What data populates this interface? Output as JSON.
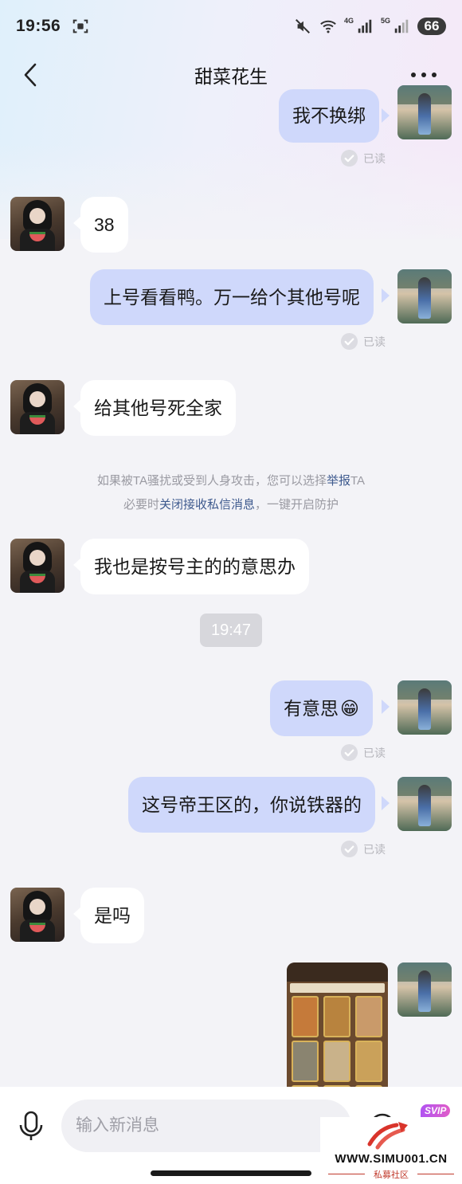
{
  "status_bar": {
    "time": "19:56",
    "battery": "66",
    "net_4g": "4G",
    "net_5g": "5G"
  },
  "header": {
    "title": "甜菜花生"
  },
  "messages": [
    {
      "side": "right",
      "text": "我不换绑",
      "read": "已读"
    },
    {
      "side": "left",
      "text": "38"
    },
    {
      "side": "right",
      "text": "上号看看鸭。万一给个其他号呢",
      "read": "已读"
    },
    {
      "side": "left",
      "text": "给其他号死全家"
    },
    {
      "side": "left",
      "text": "我也是按号主的的意思办"
    },
    {
      "side": "right",
      "text": "有意思",
      "emoji": "😁",
      "read": "已读"
    },
    {
      "side": "right",
      "text": "这号帝王区的，你说铁器的",
      "read": "已读"
    },
    {
      "side": "left",
      "text": "是吗"
    },
    {
      "side": "right",
      "type": "image"
    }
  ],
  "notice": {
    "line1_pre": "如果被TA骚扰或受到人身攻击，您可以选择",
    "line1_link": "举报",
    "line1_post": "TA",
    "line2_pre": "必要时",
    "line2_link": "关闭接收私信消息",
    "line2_post": "，一键开启防护"
  },
  "timestamp": "19:47",
  "input": {
    "placeholder": "输入新消息"
  },
  "svip": "SVIP",
  "watermark": {
    "url": "WWW.SIMU001.CN",
    "sub": "私募社区"
  },
  "colors": {
    "bubble_right": "#cfd8fb",
    "bubble_left": "#ffffff",
    "link": "#3e5a8e"
  }
}
